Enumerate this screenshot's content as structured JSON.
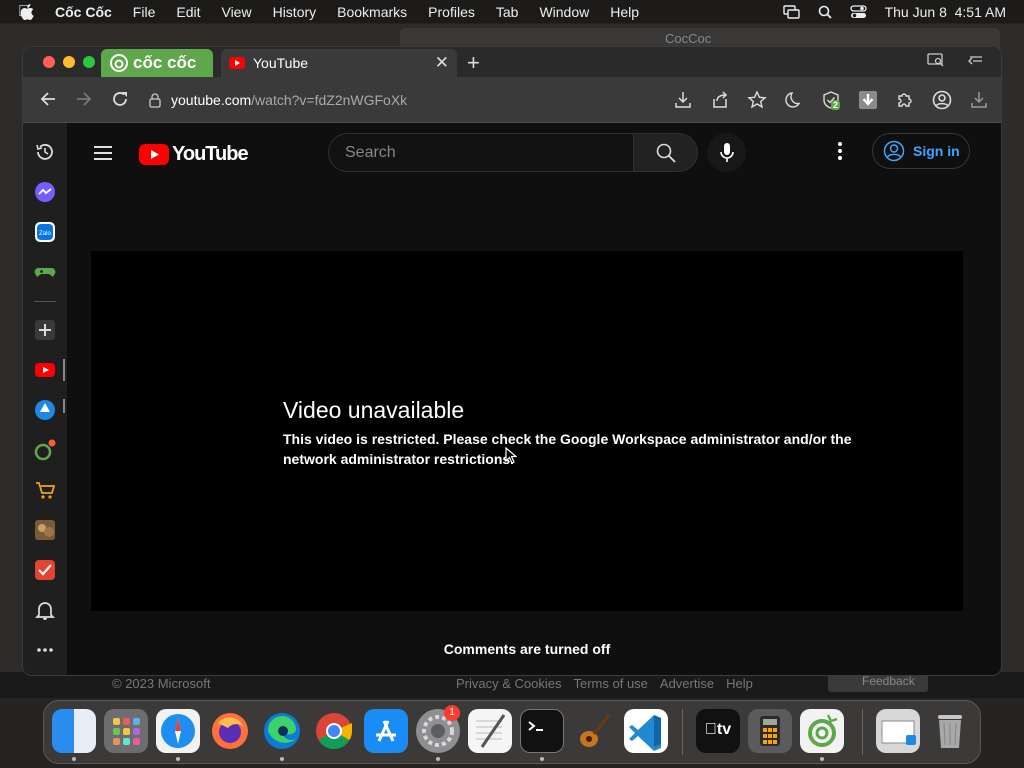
{
  "menubar": {
    "app_name": "Cốc Cốc",
    "items": [
      "File",
      "Edit",
      "View",
      "History",
      "Bookmarks",
      "Profiles",
      "Tab",
      "Window",
      "Help"
    ],
    "clock": "Thu Jun 8  4:51 AM"
  },
  "background_window": {
    "title": "CocCoc",
    "footer_copyright": "© 2023 Microsoft",
    "footer_links": [
      "Privacy & Cookies",
      "Terms of use",
      "Advertise",
      "Help"
    ],
    "feedback_label": "Feedback"
  },
  "browser": {
    "brand_tab_label": "cốc cốc",
    "active_tab_title": "YouTube",
    "url_host": "youtube.com",
    "url_path": "/watch?v=fdZ2nWGFoXk",
    "extension_badge": "2"
  },
  "youtube": {
    "logo_text": "YouTube",
    "search_placeholder": "Search",
    "sign_in_label": "Sign in",
    "error_title": "Video unavailable",
    "error_message": "This video is restricted. Please check the Google Workspace administrator and/or the network administrator restrictions.",
    "comments_status": "Comments are turned off"
  },
  "dock": {
    "settings_badge": "1",
    "apple_tv_label": "tv"
  },
  "colors": {
    "youtube_red": "#ff0000",
    "coccoc_green": "#5fa74b",
    "link_blue": "#3ea6ff"
  }
}
